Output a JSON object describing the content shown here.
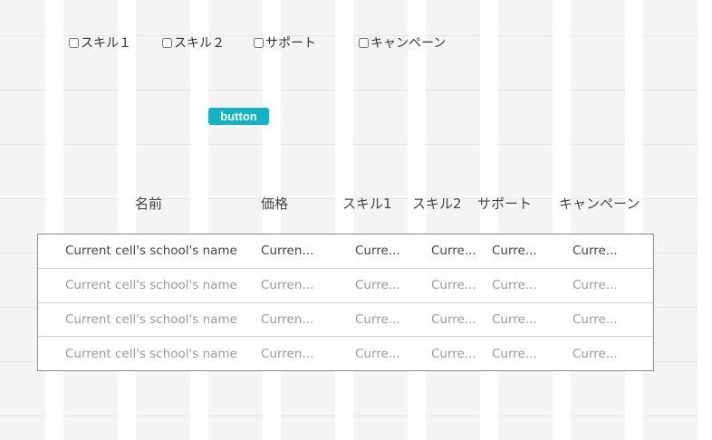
{
  "filters": [
    {
      "label": "スキル１",
      "checked": false
    },
    {
      "label": "スキル２",
      "checked": false
    },
    {
      "label": "サポート",
      "checked": false
    },
    {
      "label": "キャンペーン",
      "checked": false
    }
  ],
  "button": {
    "label": "button",
    "color": "#12b3c4"
  },
  "columns": [
    "名前",
    "価格",
    "スキル1",
    "スキル2",
    "サポート",
    "キャンペーン"
  ],
  "rows": [
    [
      "Current cell's school's name",
      "Curren...",
      "Curre...",
      "Curre...",
      "Curre...",
      "Curre..."
    ],
    [
      "Current cell's school's name",
      "Curren...",
      "Curre...",
      "Curre...",
      "Curre...",
      "Curre..."
    ],
    [
      "Current cell's school's name",
      "Curren...",
      "Curre...",
      "Curre...",
      "Curre...",
      "Curre..."
    ],
    [
      "Current cell's school's name",
      "Curren...",
      "Curre...",
      "Curre...",
      "Curre...",
      "Curre..."
    ]
  ]
}
